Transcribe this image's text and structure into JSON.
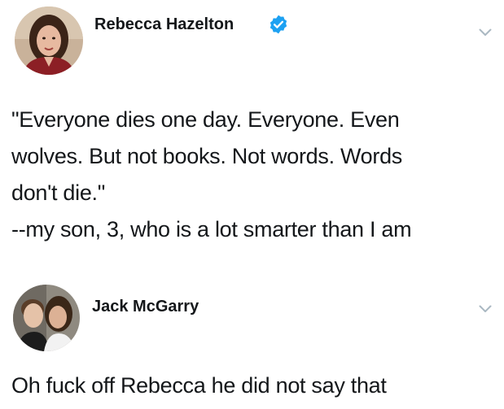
{
  "tweets": [
    {
      "author": "Rebecca Hazelton",
      "verified": true,
      "text_lines": [
        "\"Everyone dies one day. Everyone. Even",
        "wolves. But not books. Not words. Words",
        "don't die.\"",
        "--my son, 3, who is a lot smarter than I am"
      ],
      "avatar_icon": "avatar-photo-woman",
      "menu_icon": "chevron-down-icon"
    },
    {
      "author": "Jack McGarry",
      "verified": false,
      "text_lines": [
        "Oh fuck off Rebecca he did not say that"
      ],
      "avatar_icon": "avatar-photo-couple",
      "menu_icon": "chevron-down-icon"
    }
  ],
  "colors": {
    "verified_badge": "#1da1f2",
    "chevron": "#aab8c2",
    "text": "#14171a"
  }
}
